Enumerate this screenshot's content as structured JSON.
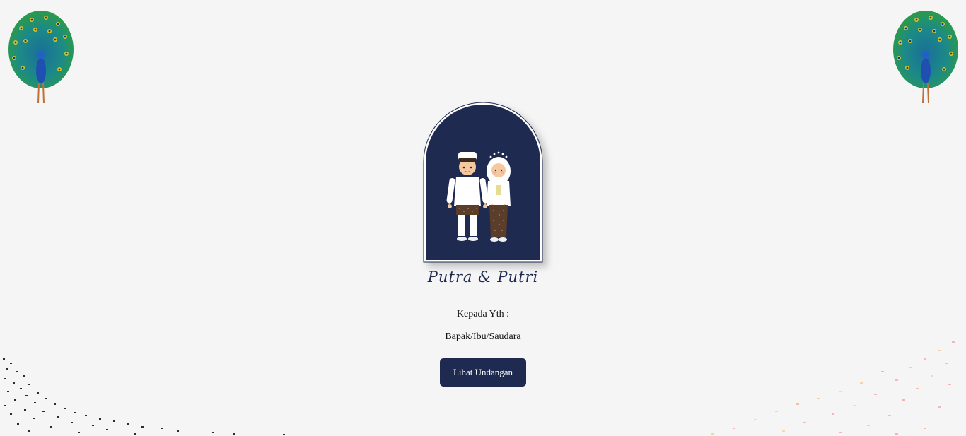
{
  "couple": {
    "names": "Putra & Putri"
  },
  "invitation": {
    "greeting": "Kepada Yth :",
    "guest": "Bapak/Ibu/Saudara",
    "open_button_label": "Lihat Undangan"
  },
  "theme": {
    "primary": "#1e2a50",
    "background": "#f5f5f5"
  },
  "icons": {
    "corner_left": "peacock-icon",
    "corner_right": "peacock-icon"
  }
}
